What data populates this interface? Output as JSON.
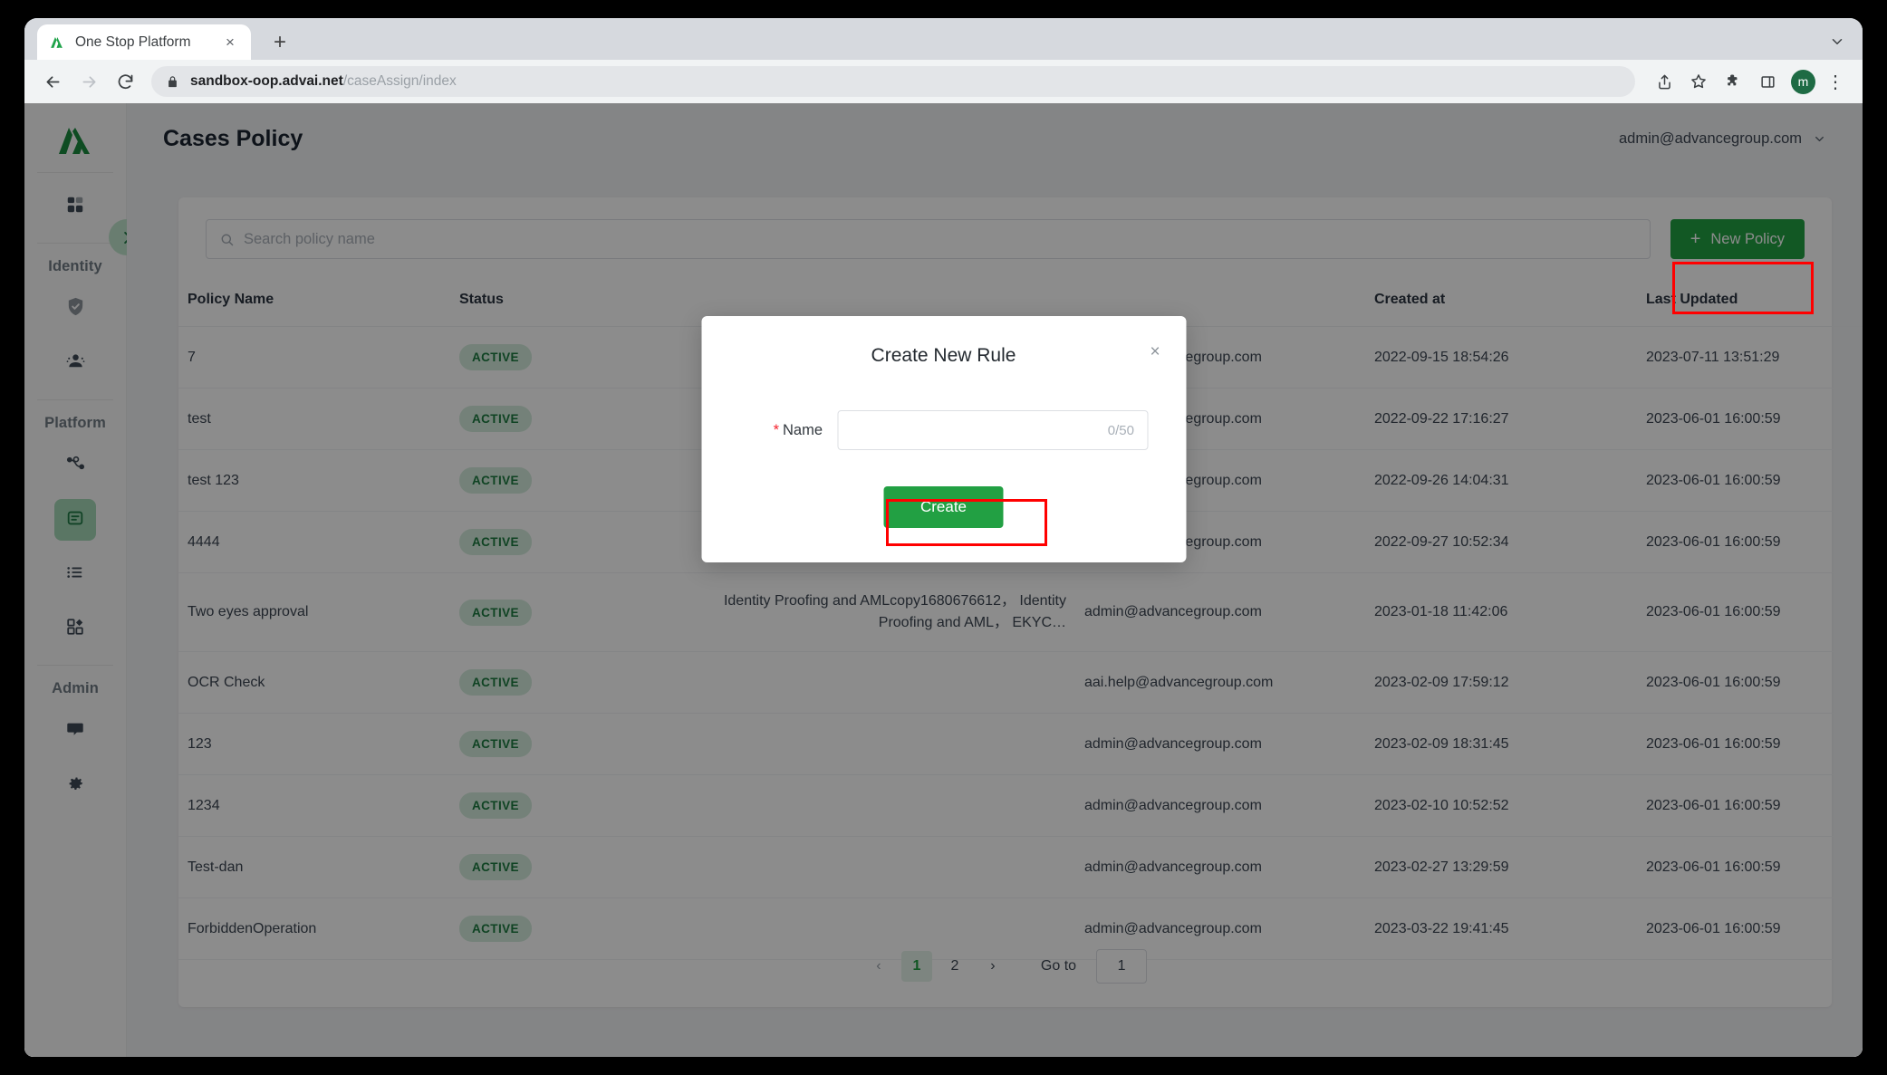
{
  "browser": {
    "tab": {
      "title": "One Stop Platform",
      "favicon": "advai-logo-icon",
      "close_label": "×"
    },
    "new_tab_label": "+",
    "nav": {
      "back": "back-icon",
      "forward": "forward-icon",
      "reload": "reload-icon"
    },
    "omnibox": {
      "lock": "lock-icon",
      "url_host": "sandbox-oop.advai.net",
      "url_path": "/caseAssign/index"
    },
    "toolbar_icons": [
      "share-icon",
      "bookmark-star-icon",
      "extensions-puzzle-icon",
      "side-panel-icon"
    ],
    "profile_initial": "m",
    "menu_label": "⋮"
  },
  "sidebar": {
    "logo": "advai-logo-icon",
    "expand_button": "expand-sidebar-chevron-icon",
    "groups": [
      {
        "label": "",
        "items": [
          {
            "name": "dashboard",
            "icon": "dashboard-grid-icon",
            "active": false
          }
        ]
      },
      {
        "label": "Identity",
        "items": [
          {
            "name": "identity-verification",
            "icon": "shield-check-icon",
            "active": false
          },
          {
            "name": "user-management",
            "icon": "users-icon",
            "active": false
          }
        ]
      },
      {
        "label": "Platform",
        "items": [
          {
            "name": "workflow",
            "icon": "workflow-node-icon",
            "active": false
          },
          {
            "name": "cases-policy",
            "icon": "document-list-icon",
            "active": true
          },
          {
            "name": "case-list",
            "icon": "list-icon",
            "active": false
          },
          {
            "name": "apps",
            "icon": "apps-grid-icon",
            "active": false
          }
        ]
      },
      {
        "label": "Admin",
        "items": [
          {
            "name": "messages",
            "icon": "chat-bubble-icon",
            "active": false
          },
          {
            "name": "settings",
            "icon": "gear-icon",
            "active": false
          }
        ]
      }
    ]
  },
  "header": {
    "title": "Cases Policy",
    "user_email": "admin@advancegroup.com",
    "caret": "chevron-down-icon"
  },
  "toolbar": {
    "search_placeholder": "Search policy name",
    "search_value": "",
    "search_icon": "search-icon",
    "new_policy_label": "New Policy",
    "new_policy_plus": "+"
  },
  "table": {
    "columns": [
      "Policy Name",
      "Status",
      "",
      "",
      "Created at",
      "Last Updated"
    ],
    "rows": [
      {
        "name": "7",
        "status": "ACTIVE",
        "flow": "",
        "owner": "admin@advancegroup.com",
        "created": "2022-09-15 18:54:26",
        "updated": "2023-07-11 13:51:29"
      },
      {
        "name": "test",
        "status": "ACTIVE",
        "flow": "",
        "owner": "admin@advancegroup.com",
        "created": "2022-09-22 17:16:27",
        "updated": "2023-06-01 16:00:59"
      },
      {
        "name": "test 123",
        "status": "ACTIVE",
        "flow": "",
        "owner": "admin@advancegroup.com",
        "created": "2022-09-26 14:04:31",
        "updated": "2023-06-01 16:00:59"
      },
      {
        "name": "4444",
        "status": "ACTIVE",
        "flow": "",
        "owner": "admin@advancegroup.com",
        "created": "2022-09-27 10:52:34",
        "updated": "2023-06-01 16:00:59"
      },
      {
        "name": "Two eyes approval",
        "status": "ACTIVE",
        "flow": "Identity Proofing and AMLcopy1680676612， Identity Proofing and AML， EKYC…",
        "owner": "admin@advancegroup.com",
        "created": "2023-01-18 11:42:06",
        "updated": "2023-06-01 16:00:59"
      },
      {
        "name": "OCR Check",
        "status": "ACTIVE",
        "flow": "",
        "owner": "aai.help@advancegroup.com",
        "created": "2023-02-09 17:59:12",
        "updated": "2023-06-01 16:00:59"
      },
      {
        "name": "123",
        "status": "ACTIVE",
        "flow": "",
        "owner": "admin@advancegroup.com",
        "created": "2023-02-09 18:31:45",
        "updated": "2023-06-01 16:00:59"
      },
      {
        "name": "1234",
        "status": "ACTIVE",
        "flow": "",
        "owner": "admin@advancegroup.com",
        "created": "2023-02-10 10:52:52",
        "updated": "2023-06-01 16:00:59"
      },
      {
        "name": "Test-dan",
        "status": "ACTIVE",
        "flow": "",
        "owner": "admin@advancegroup.com",
        "created": "2023-02-27 13:29:59",
        "updated": "2023-06-01 16:00:59"
      },
      {
        "name": "ForbiddenOperation",
        "status": "ACTIVE",
        "flow": "",
        "owner": "admin@advancegroup.com",
        "created": "2023-03-22 19:41:45",
        "updated": "2023-06-01 16:00:59"
      }
    ]
  },
  "pagination": {
    "prev": "‹",
    "next": "›",
    "pages": [
      "1",
      "2"
    ],
    "current": "1",
    "goto_label": "Go to",
    "goto_value": "1"
  },
  "modal": {
    "title": "Create New Rule",
    "close": "×",
    "field_label": "Name",
    "required_star": "*",
    "field_value": "",
    "field_placeholder": "",
    "counter": "0/50",
    "submit_label": "Create"
  },
  "colors": {
    "brand_green": "#22a043",
    "badge_green_bg": "#d4ecdc",
    "badge_green_text": "#1c7a40",
    "annotation_red": "#ff0000",
    "sidebar_active": "#a5d8b6"
  }
}
